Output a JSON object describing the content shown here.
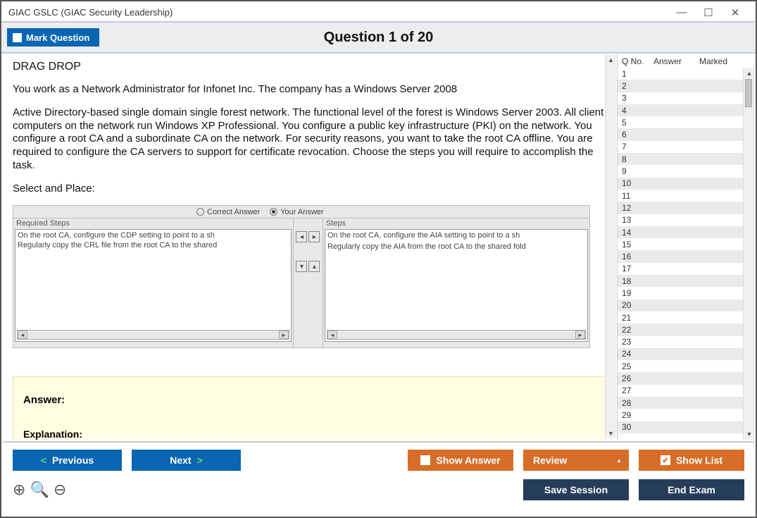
{
  "title": "GIAC GSLC (GIAC Security Leadership)",
  "header": {
    "mark_question": "Mark Question",
    "question_title": "Question 1 of 20"
  },
  "question": {
    "type_label": "DRAG DROP",
    "para1": "You work as a Network Administrator for Infonet Inc. The company has a Windows Server 2008",
    "para2": "Active Directory-based single domain single forest network. The functional level of the forest is Windows Server 2003. All client computers on the network run Windows XP Professional. You configure a public key infrastructure (PKI) on the network. You configure a root CA and a subordinate CA on the network. For security reasons, you want to take the root CA offline. You are required to configure the CA servers to support for certificate revocation. Choose the steps you will require to accomplish the task.",
    "select_place": "Select and Place:"
  },
  "dragdrop": {
    "correct_answer": "Correct Answer",
    "your_answer": "Your Answer",
    "left_header": "Required Steps",
    "right_header": "Steps",
    "left_items": [
      "On the root CA, configure the CDP setting to point to a sh",
      "Regularly copy the CRL file from the root CA to the shared"
    ],
    "right_items": [
      "On the root CA, configure the AIA setting to point to a sh",
      "",
      "Regularly copy the AIA from the root CA to the shared fold"
    ]
  },
  "answer_box": {
    "answer_label": "Answer:",
    "explanation_label": "Explanation:"
  },
  "sidebar": {
    "col_qno": "Q No.",
    "col_answer": "Answer",
    "col_marked": "Marked",
    "rows": [
      "1",
      "2",
      "3",
      "4",
      "5",
      "6",
      "7",
      "8",
      "9",
      "10",
      "11",
      "12",
      "13",
      "14",
      "15",
      "16",
      "17",
      "18",
      "19",
      "20",
      "21",
      "22",
      "23",
      "24",
      "25",
      "26",
      "27",
      "28",
      "29",
      "30"
    ]
  },
  "footer": {
    "previous": "Previous",
    "next": "Next",
    "show_answer": "Show Answer",
    "review": "Review",
    "show_list": "Show List",
    "save_session": "Save Session",
    "end_exam": "End Exam"
  }
}
